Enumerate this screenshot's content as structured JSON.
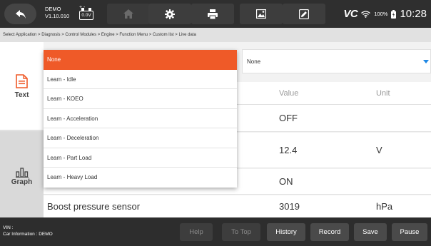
{
  "topbar": {
    "version_line1": "DEMO",
    "version_line2": "V1.10.010",
    "voltage": "0.0V",
    "battery_pct": "100%",
    "time": "10:28",
    "vci_label": "VC"
  },
  "breadcrumb": "Select Application > Diagnosis > Control Modules > Engine > Function Menu > Custom list >  Live data",
  "leftnav": {
    "text_label": "Text",
    "graph_label": "Graph"
  },
  "filter": {
    "selected": "None"
  },
  "dropdown": {
    "items": [
      "None",
      "Learn - Idle",
      "Learn - KOEO",
      "Learn - Acceleration",
      "Learn - Deceleration",
      "Learn - Part Load",
      "Learn - Heavy Load"
    ],
    "selected_index": 0
  },
  "table": {
    "headers": {
      "value": "Value",
      "unit": "Unit"
    },
    "rows": [
      {
        "name": "",
        "value": "OFF",
        "unit": ""
      },
      {
        "name": "",
        "value": "12.4",
        "unit": "V"
      },
      {
        "name": "",
        "value": "ON",
        "unit": ""
      },
      {
        "name": "Boost pressure sensor",
        "value": "3019",
        "unit": "hPa"
      }
    ]
  },
  "bottombar": {
    "vin_label": "VIN :",
    "car_info": "Car Information : DEMO",
    "buttons": [
      "Help",
      "To Top",
      "History",
      "Record",
      "Save",
      "Pause"
    ]
  },
  "colors": {
    "accent": "#ef5a28",
    "topbar": "#2f2f2f",
    "bottombar": "#2d2d2d",
    "arrow": "#1e88e5"
  }
}
